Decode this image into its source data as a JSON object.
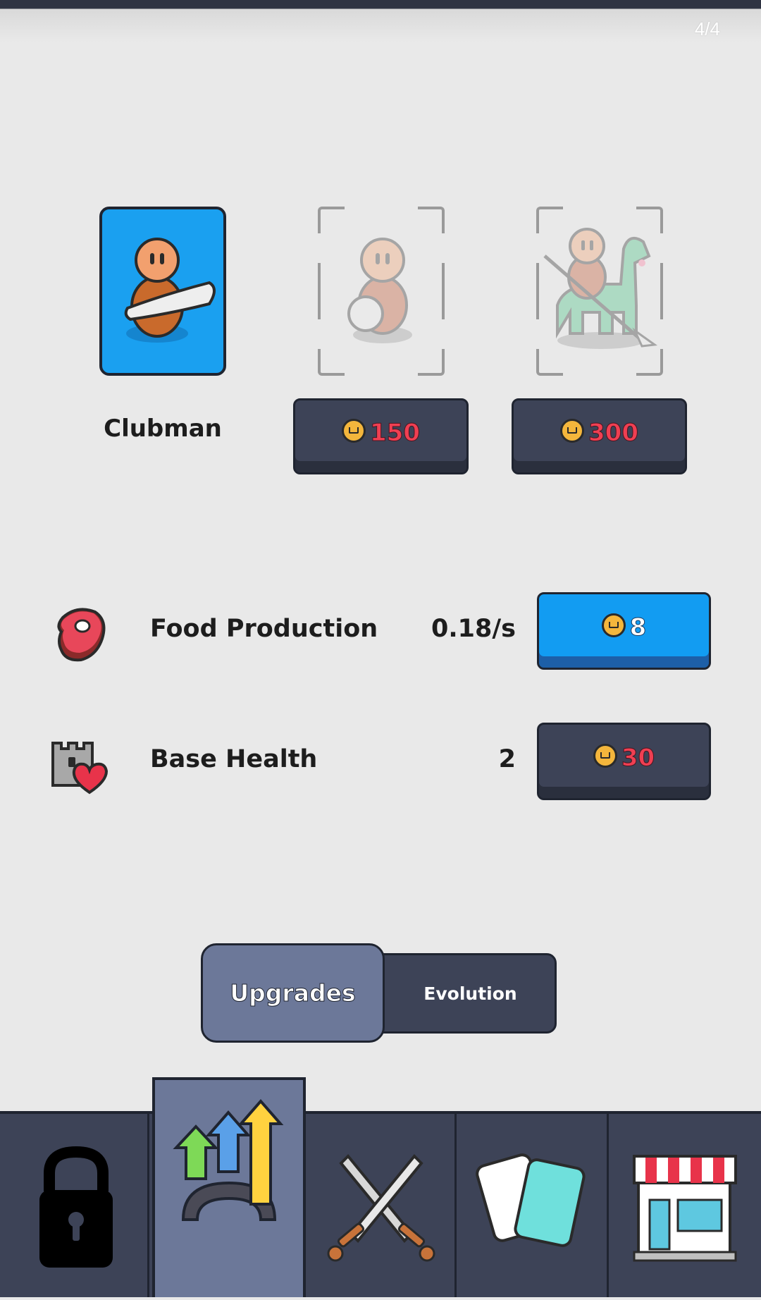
{
  "status": {
    "page_indicator": "4/4"
  },
  "units": [
    {
      "name": "Clubman",
      "state": "owned"
    },
    {
      "state": "locked",
      "cost": "150"
    },
    {
      "state": "locked",
      "cost": "300"
    }
  ],
  "stats": [
    {
      "label": "Food Production",
      "value": "0.18/s",
      "cost": "8",
      "icon": "meat-icon"
    },
    {
      "label": "Base Health",
      "value": "2",
      "cost": "30",
      "icon": "castle-heart-icon"
    }
  ],
  "tabs": {
    "upgrades": "Upgrades",
    "evolution": "Evolution"
  },
  "nav": [
    "lock-icon",
    "upgrade-arrows-icon",
    "crossed-swords-icon",
    "cards-icon",
    "shop-icon"
  ],
  "colors": {
    "accent_blue": "#129cf2",
    "dark_button": "#3d4357",
    "price_red": "#f03f52",
    "active_tab": "#6c7899"
  }
}
